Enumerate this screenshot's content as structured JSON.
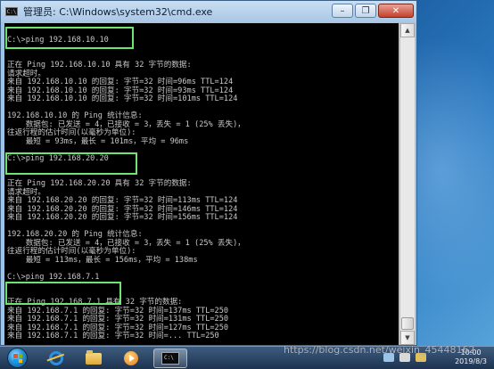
{
  "window": {
    "title": "管理员: C:\\Windows\\system32\\cmd.exe",
    "icon_text": "C:\\",
    "minimize_glyph": "–",
    "maximize_glyph": "❐",
    "close_glyph": "✕"
  },
  "console": {
    "lines": [
      "",
      "C:\\>ping 192.168.10.10",
      "",
      "",
      "正在 Ping 192.168.10.10 具有 32 字节的数据:",
      "请求超时。",
      "来自 192.168.10.10 的回复: 字节=32 时间=96ms TTL=124",
      "来自 192.168.10.10 的回复: 字节=32 时间=93ms TTL=124",
      "来自 192.168.10.10 的回复: 字节=32 时间=101ms TTL=124",
      "",
      "192.168.10.10 的 Ping 统计信息:",
      "    数据包: 已发送 = 4，已接收 = 3，丢失 = 1 (25% 丢失)，",
      "往返行程的估计时间(以毫秒为单位):",
      "    最短 = 93ms，最长 = 101ms，平均 = 96ms",
      "",
      "C:\\>ping 192.168.20.20",
      "",
      "",
      "正在 Ping 192.168.20.20 具有 32 字节的数据:",
      "请求超时。",
      "来自 192.168.20.20 的回复: 字节=32 时间=113ms TTL=124",
      "来自 192.168.20.20 的回复: 字节=32 时间=146ms TTL=124",
      "来自 192.168.20.20 的回复: 字节=32 时间=156ms TTL=124",
      "",
      "192.168.20.20 的 Ping 统计信息:",
      "    数据包: 已发送 = 4，已接收 = 3，丢失 = 1 (25% 丢失)，",
      "往返行程的估计时间(以毫秒为单位):",
      "    最短 = 113ms，最长 = 156ms，平均 = 138ms",
      "",
      "C:\\>ping 192.168.7.1",
      "",
      "",
      "正在 Ping 192.168.7.1 具有 32 字节的数据:",
      "来自 192.168.7.1 的回复: 字节=32 时间=137ms TTL=250",
      "来自 192.168.7.1 的回复: 字节=32 时间=131ms TTL=250",
      "来自 192.168.7.1 的回复: 字节=32 时间=127ms TTL=250",
      "来自 192.168.7.1 的回复: 字节=32 时间=... TTL=250"
    ]
  },
  "taskbar": {
    "clock_time": "10:00",
    "clock_date": "2019/8/3",
    "items": [
      "ie-icon",
      "folder-icon",
      "media-icon",
      "cmd-icon"
    ]
  },
  "watermark": "https://blog.csdn.net/weixin_45448162",
  "colors": {
    "console_bg": "#000000",
    "console_fg": "#c8c8c8",
    "highlight": "#6fe36f",
    "close_button": "#c5412c"
  }
}
